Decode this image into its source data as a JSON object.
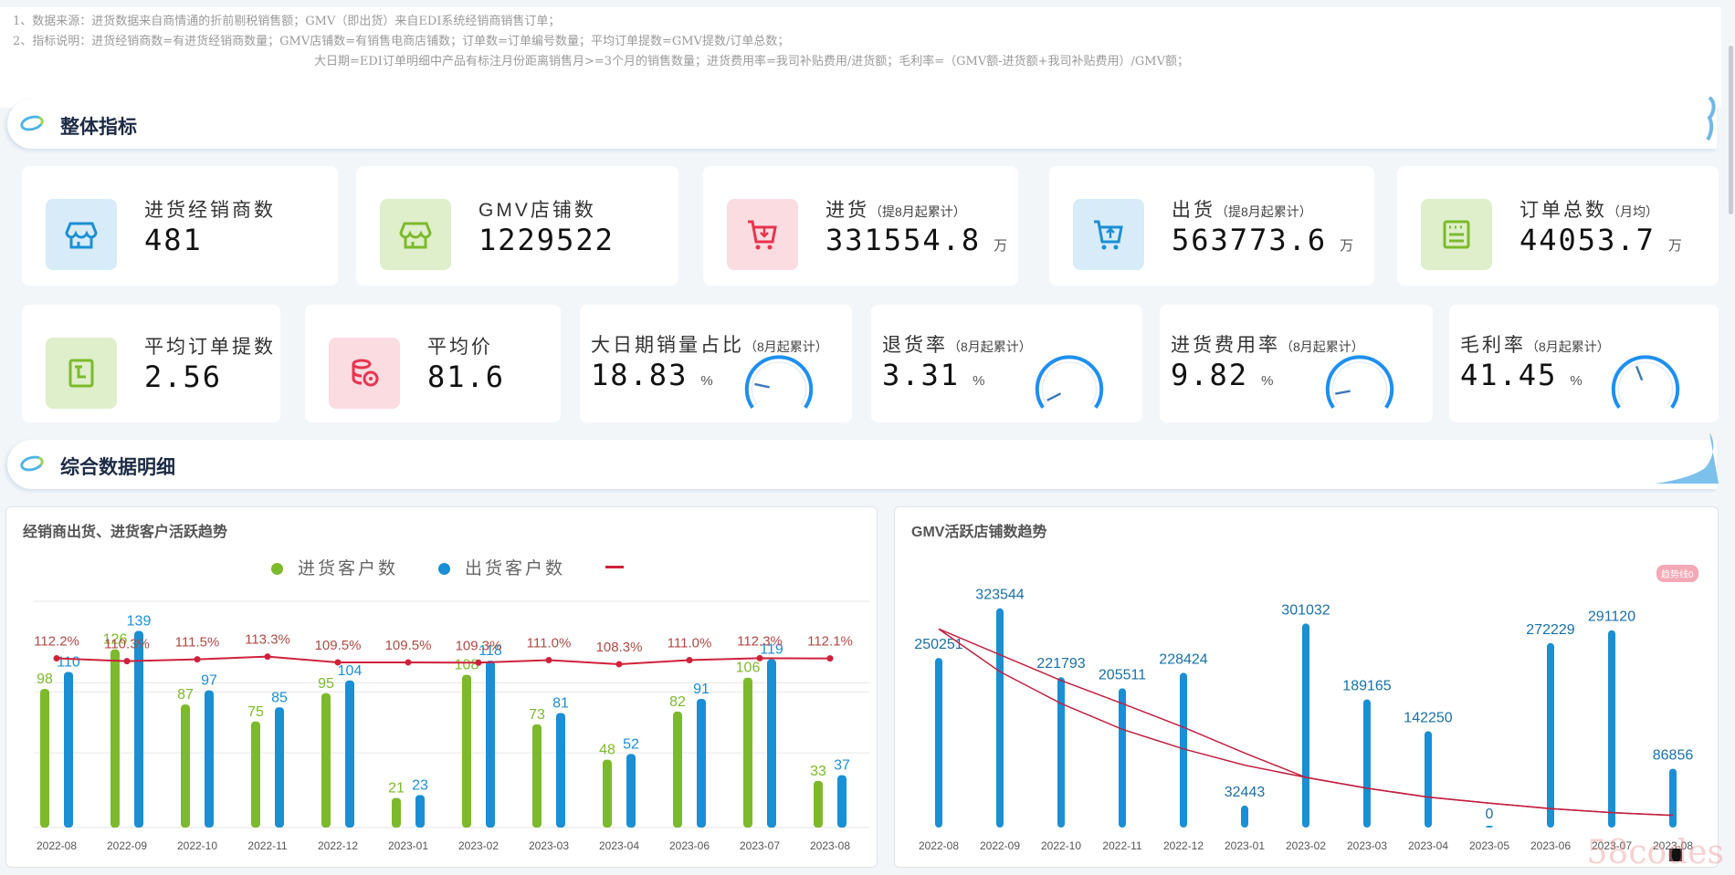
{
  "notes": [
    "1、数据来源：进货数据来自商情通的折前剔税销售额；GMV（即出货）来自EDI系统经销商销售订单；",
    "2、指标说明：进货经销商数=有进货经销商数量；GMV店铺数=有销售电商店铺数；订单数=订单编号数量；平均订单提数=GMV提数/订单总数；",
    "大日期=EDI订单明细中产品有标注月份距离销售月>=3个月的销售数量；进货费用率=我司补贴费用/进货额；毛利率=（GMV额-进货额+我司补贴费用）/GMV额；"
  ],
  "sections": {
    "overall": "整体指标",
    "detail": "综合数据明细"
  },
  "kpi_row1": [
    {
      "label": "进货经销商数",
      "sub": "",
      "value": "481",
      "unit": "",
      "icon": "store-icon",
      "color": "#1a8fd4",
      "bg": "#d7ebf8"
    },
    {
      "label": "GMV店铺数",
      "sub": "",
      "value": "1229522",
      "unit": "",
      "icon": "store-icon",
      "color": "#7cba2b",
      "bg": "#dfeecb"
    },
    {
      "label": "进货",
      "sub": "（提8月起累计）",
      "value": "331554.8",
      "unit": "万",
      "icon": "cart-down-icon",
      "color": "#e8344e",
      "bg": "#fadce1"
    },
    {
      "label": "出货",
      "sub": "（提8月起累计）",
      "value": "563773.6",
      "unit": "万",
      "icon": "cart-up-icon",
      "color": "#1a8fd4",
      "bg": "#d7ebf8"
    },
    {
      "label": "订单总数",
      "sub": "（月均）",
      "value": "44053.7",
      "unit": "万",
      "icon": "order-list-icon",
      "color": "#7cba2b",
      "bg": "#dfeecb"
    }
  ],
  "kpi_row2": [
    {
      "label": "平均订单提数",
      "value": "2.56",
      "icon": "order-icon",
      "color": "#7cba2b",
      "bg": "#dfeecb"
    },
    {
      "label": "平均价",
      "value": "81.6",
      "icon": "coins-icon",
      "color": "#e8344e",
      "bg": "#fadce1"
    }
  ],
  "gauges": [
    {
      "label": "大日期销量占比",
      "sub": "（8月起累计）",
      "value": "18.83",
      "unit": "%",
      "pct": 18.83
    },
    {
      "label": "退货率",
      "sub": "（8月起累计）",
      "value": "3.31",
      "unit": "%",
      "pct": 3.31
    },
    {
      "label": "进货费用率",
      "sub": "（8月起累计）",
      "value": "9.82",
      "unit": "%",
      "pct": 9.82
    },
    {
      "label": "毛利率",
      "sub": "（8月起累计）",
      "value": "41.45",
      "unit": "%",
      "pct": 41.45
    }
  ],
  "chart_data": [
    {
      "type": "bar",
      "title": "经销商出货、进货客户活跃趋势",
      "categories": [
        "2022-08",
        "2022-09",
        "2022-10",
        "2022-11",
        "2022-12",
        "2023-01",
        "2023-02",
        "2023-03",
        "2023-04",
        "2023-06",
        "2023-07",
        "2023-08"
      ],
      "series": [
        {
          "name": "进货客户数",
          "color": "#7cba2b",
          "values": [
            98,
            126,
            87,
            75,
            95,
            21,
            108,
            73,
            48,
            82,
            106,
            33
          ]
        },
        {
          "name": "出货客户数",
          "color": "#1a8fd4",
          "values": [
            110,
            139,
            97,
            85,
            104,
            23,
            118,
            81,
            52,
            91,
            119,
            37
          ]
        },
        {
          "name": "",
          "type": "line",
          "color": "#d0213a",
          "labels": [
            "112.2%",
            "110.3%",
            "111.5%",
            "113.3%",
            "109.5%",
            "109.5%",
            "109.3%",
            "111.0%",
            "108.3%",
            "111.0%",
            "112.3%",
            "112.1%"
          ],
          "values": [
            112.2,
            110.3,
            111.5,
            113.3,
            109.5,
            109.5,
            109.3,
            111.0,
            108.3,
            111.0,
            112.3,
            112.1
          ]
        }
      ],
      "ylim": [
        0,
        160
      ],
      "y2lim": [
        0,
        150
      ],
      "grid": true,
      "legend": "top-center"
    },
    {
      "type": "bar",
      "title": "GMV活跃店铺数趋势",
      "categories": [
        "2022-08",
        "2022-09",
        "2022-10",
        "2022-11",
        "2022-12",
        "2023-01",
        "2023-02",
        "2023-03",
        "2023-04",
        "2023-05",
        "2023-06",
        "2023-07",
        "2023-08"
      ],
      "series": [
        {
          "name": "GMV活跃店铺数",
          "color": "#1a8fd4",
          "values": [
            250251,
            323544,
            221793,
            205511,
            228424,
            32443,
            301032,
            189165,
            142250,
            0,
            272229,
            291120,
            86856
          ]
        }
      ],
      "trendlines": [
        {
          "color": "#c2203f",
          "values": [
            293000,
            230000,
            183000,
            145000,
            116000,
            92000,
            74000,
            58000,
            45000,
            36000,
            28000,
            22000,
            18000
          ]
        },
        {
          "color": "#c2203f",
          "values": [
            293000,
            255000,
            217000,
            183000,
            148000,
            110000,
            74000,
            58000,
            45000,
            36000,
            28000,
            22000,
            18000
          ]
        }
      ],
      "badge": "趋势线0",
      "ylim": [
        0,
        350000
      ],
      "grid": false
    }
  ],
  "watermark": "58codes"
}
